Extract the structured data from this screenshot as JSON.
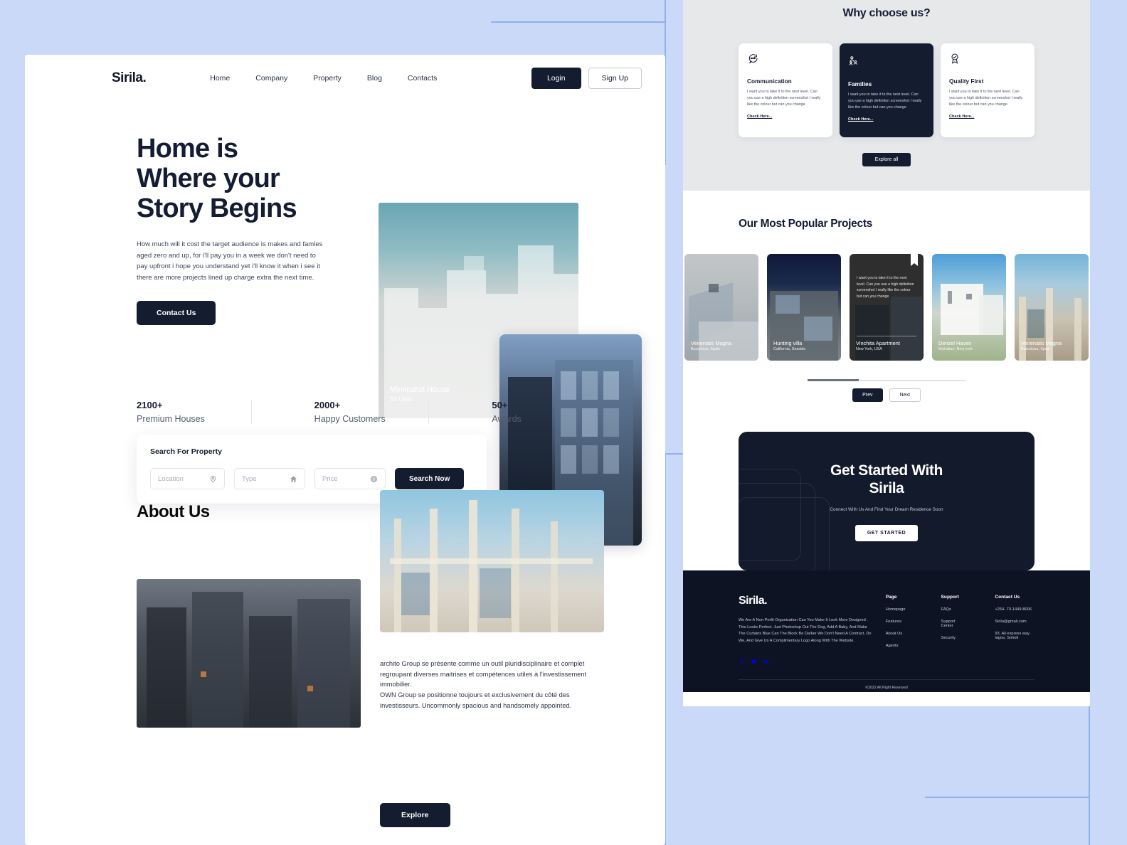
{
  "theme": {
    "accent": "#141c2f",
    "page_bg": "#c9d9f7",
    "why_bg": "#e7e8ea",
    "footer_bg": "#0d1322"
  },
  "nav": {
    "logo": "Sirila.",
    "links": [
      {
        "label": "Home"
      },
      {
        "label": "Company"
      },
      {
        "label": "Property"
      },
      {
        "label": "Blog"
      },
      {
        "label": "Contacts"
      }
    ],
    "login": "Login",
    "signup": "Sign Up"
  },
  "hero": {
    "title_line1": "Home is",
    "title_line2": "Where your",
    "title_line3": "Story Begins",
    "description": "How much will it cost the target audience is makes and famles aged zero and up, for i'll pay you in a week we don't need to pay upfront i hope you understand yet i'll know it when i see it there are more projects lined up charge extra the next time.",
    "cta": "Contact Us",
    "image_caption_title": "Minimalist House",
    "image_caption_sub": "50 Units"
  },
  "search": {
    "title": "Search For Property",
    "location_placeholder": "Location",
    "type_placeholder": "Type",
    "price_placeholder": "Price",
    "button": "Search Now",
    "location_icon": "map-pin-icon",
    "type_icon": "home-icon",
    "price_icon": "dollar-icon"
  },
  "stats": [
    {
      "number": "2100+",
      "label": "Premium Houses"
    },
    {
      "number": "2000+",
      "label": "Happy Customers"
    },
    {
      "number": "50+",
      "label": "Awards"
    }
  ],
  "about": {
    "heading": "About Us",
    "paragraph": "archito Group se présente comme un outil pluridisciplinaire et complet regroupant diverses maitrises et compétences utiles à l'investissement immobilier.\nOWN Group se positionne toujours et exclusivement du côté des investisseurs. Uncommonly spacious and handsomely appointed.",
    "cta": "Explore"
  },
  "why": {
    "heading": "Why choose us?",
    "cards": [
      {
        "icon": "chat-bubble-icon",
        "title": "Communication",
        "body": "I want you to take it to the next level. Can you use a high definition screenshot I really like the colour but can you change",
        "link": "Check Here..."
      },
      {
        "icon": "family-icon",
        "title": "Families",
        "body": "I want you to take it to the next level. Can you use a high definition screenshot I really like the colour but can you change",
        "link": "Check Here..."
      },
      {
        "icon": "quality-badge-icon",
        "title": "Quality First",
        "body": "I want you to take it to the next level. Can you use a high definition screenshot I really like the colour but can you change",
        "link": "Check Here..."
      }
    ],
    "explore_all": "Explore all"
  },
  "projects": {
    "heading": "Our Most Popular Projects",
    "cards": [
      {
        "title": "Venenatis Magna",
        "location": "Barcelona, Spain"
      },
      {
        "title": "Hunting villa",
        "location": "California, Seaside"
      },
      {
        "title": "Vinchita Apartment",
        "location": "New York, USA",
        "blurb": "I want you to take it to the next level. Can you use a high definition screenshot I really like the colour but can you change",
        "featured": true
      },
      {
        "title": "Denzel Haven",
        "location": "Mohattan, New york"
      },
      {
        "title": "Venenatis Magna",
        "location": "Barcelona, Spain"
      }
    ],
    "prev": "Prev",
    "next": "Next"
  },
  "cta": {
    "title_line1": "Get Started With",
    "title_line2": "Sirila",
    "subtitle": "Connect With Us And Find Your Dream Residence Soon",
    "button": "GET STARTED"
  },
  "footer": {
    "logo": "Sirila.",
    "description": "We Are A Non-Profit Organization Can You Make It Look More Designed . This Looks Perfect. Just Photoshop Out The Dog, Add A Baby, And Make The Curtains Blue Can The Block Be Darker We Don't Need A Contract, Do We, And Give Us A Complimentary Logo Along With The Website.",
    "socials": [
      {
        "icon": "facebook-icon"
      },
      {
        "icon": "twitter-icon"
      },
      {
        "icon": "linkedin-icon"
      }
    ],
    "columns": [
      {
        "heading": "Page",
        "items": [
          "Homepage",
          "Features",
          "About Us",
          "Agents"
        ]
      },
      {
        "heading": "Support",
        "items": [
          "FAQs",
          "Support Center",
          "Security"
        ]
      },
      {
        "heading": "Contact Us",
        "items": [
          "+254- 70-1449-8006",
          "Sirila@gmail.com",
          "93, Ali express way lagos, Sohoti"
        ]
      }
    ],
    "copyright": "©2022 All Right Reserved"
  }
}
